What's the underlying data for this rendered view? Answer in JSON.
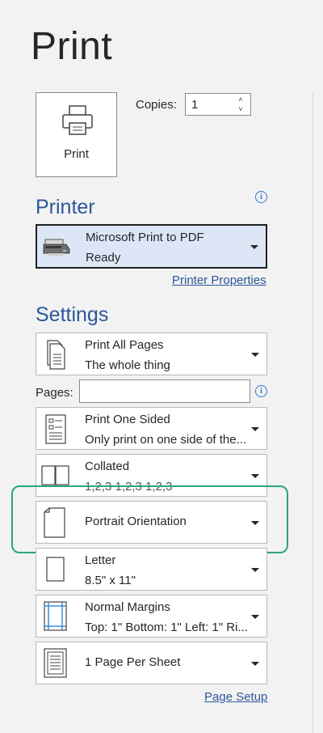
{
  "page": {
    "title": "Print"
  },
  "print_button": {
    "label": "Print",
    "icon": "printer-icon"
  },
  "copies": {
    "label": "Copies:",
    "value": "1"
  },
  "printer": {
    "heading": "Printer",
    "selected": {
      "name": "Microsoft Print to PDF",
      "status": "Ready",
      "icon": "pdf-printer-icon"
    },
    "properties_link": "Printer Properties"
  },
  "settings": {
    "heading": "Settings",
    "pages_label": "Pages:",
    "pages_value": "",
    "items": [
      {
        "title": "Print All Pages",
        "subtitle": "The whole thing",
        "icon": "pages-icon"
      },
      {
        "title": "Print One Sided",
        "subtitle": "Only print on one side of the...",
        "icon": "one-sided-icon"
      },
      {
        "title": "Collated",
        "subtitle": "1,2,3    1,2,3    1,2,3",
        "icon": "collated-icon"
      },
      {
        "title": "Portrait Orientation",
        "subtitle": "",
        "icon": "portrait-icon"
      },
      {
        "title": "Letter",
        "subtitle": "8.5\" x 11\"",
        "icon": "paper-size-icon"
      },
      {
        "title": "Normal Margins",
        "subtitle": "Top: 1\" Bottom: 1\" Left: 1\" Ri...",
        "icon": "margins-icon"
      },
      {
        "title": "1 Page Per Sheet",
        "subtitle": "",
        "icon": "pages-per-sheet-icon"
      }
    ],
    "page_setup_link": "Page Setup"
  },
  "colors": {
    "accent": "#2b579a",
    "highlight": "#2aa47e",
    "info": "#2b79d6",
    "selected_bg": "#dce6f7"
  }
}
